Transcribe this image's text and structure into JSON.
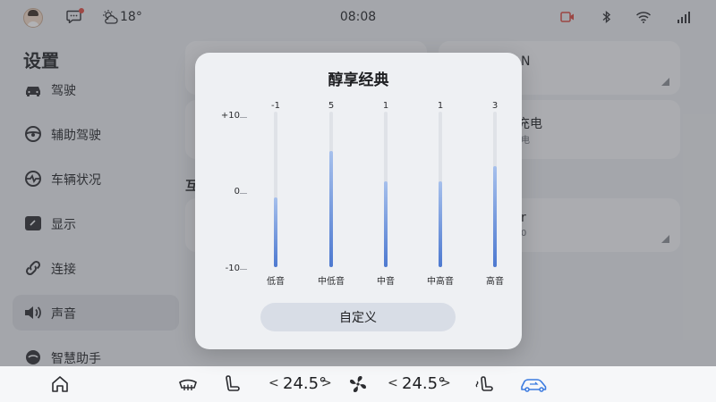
{
  "status_bar": {
    "temperature": "18°",
    "time": "08:08",
    "icons": [
      "avatar",
      "message-icon",
      "weather-icon",
      "record-icon",
      "bluetooth-icon",
      "wifi-icon",
      "signal-icon"
    ]
  },
  "sidebar": {
    "title": "设置",
    "items": [
      {
        "label": "驾驶",
        "icon": "car-icon"
      },
      {
        "label": "辅助驾驶",
        "icon": "steering-wheel-icon"
      },
      {
        "label": "车辆状况",
        "icon": "vehicle-status-icon"
      },
      {
        "label": "显示",
        "icon": "display-icon"
      },
      {
        "label": "连接",
        "icon": "link-icon"
      },
      {
        "label": "声音",
        "icon": "speaker-icon"
      },
      {
        "label": "智慧助手",
        "icon": "assistant-icon"
      }
    ],
    "active_index": 5
  },
  "background": {
    "card1_text": "N",
    "card2_text": "充电",
    "card2_sub": "电",
    "section_label": "互",
    "card3_text": "r",
    "card3_sub": "0"
  },
  "dialog": {
    "title": "醇享经典",
    "y_axis": {
      "top": "+10",
      "mid": "0",
      "bottom": "-10",
      "min": -10,
      "max": 10
    },
    "bands": [
      {
        "name": "低音",
        "value": -1,
        "value_label": "-1"
      },
      {
        "name": "中低音",
        "value": 5,
        "value_label": "5"
      },
      {
        "name": "中音",
        "value": 1,
        "value_label": "1"
      },
      {
        "name": "中高音",
        "value": 1,
        "value_label": "1"
      },
      {
        "name": "高音",
        "value": 3,
        "value_label": "3"
      }
    ],
    "button_label": "自定义"
  },
  "dock": {
    "left_temp": "24.5°",
    "right_temp": "24.5°",
    "left_chevron_prev": "<",
    "left_chevron_next": ">",
    "right_chevron_prev": "<",
    "right_chevron_next": ">",
    "icons": [
      "home-icon",
      "defrost-icon",
      "seat-icon",
      "fan-icon",
      "seat-heat-icon",
      "car-connect-icon"
    ],
    "accent_color": "#3b7be0"
  }
}
